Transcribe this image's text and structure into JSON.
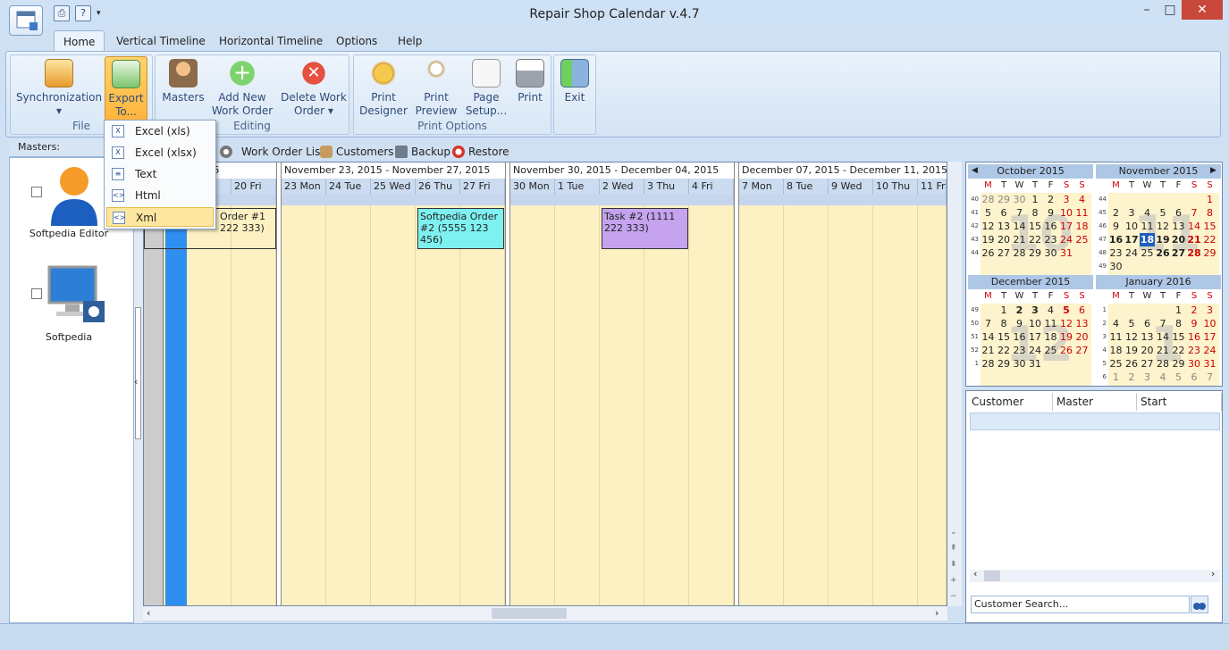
{
  "app": {
    "title": "Repair Shop Calendar v.4.7"
  },
  "tabs": [
    "Home",
    "Vertical Timeline",
    "Horizontal Timeline",
    "Options",
    "Help"
  ],
  "ribbon": {
    "file": {
      "label": "File",
      "sync": "Synchronization",
      "export1": "Export",
      "export2": "To..."
    },
    "editing": {
      "label": "Editing",
      "masters": "Masters",
      "add1": "Add New",
      "add2": "Work Order",
      "del1": "Delete Work",
      "del2": "Order"
    },
    "print": {
      "label": "Print Options",
      "designer1": "Print",
      "designer2": "Designer",
      "preview1": "Print",
      "preview2": "Preview",
      "setup1": "Page",
      "setup2": "Setup...",
      "print": "Print"
    },
    "exit": "Exit"
  },
  "export_menu": [
    "Excel (xls)",
    "Excel (xlsx)",
    "Text",
    "Html",
    "Xml"
  ],
  "masters": {
    "title": "Masters:",
    "items": [
      {
        "name": "Softpedia Editor"
      },
      {
        "name": "Softpedia"
      }
    ]
  },
  "toolbar": {
    "work_order_list": "Work Order List",
    "customers": "Customers",
    "backup": "Backup",
    "restore": "Restore"
  },
  "grid": {
    "weeks": [
      {
        "title": "mber 20, 2015",
        "days": [
          "",
          "20 Fri"
        ]
      },
      {
        "title": "November 23, 2015 - November 27, 2015",
        "days": [
          "23 Mon",
          "24 Tue",
          "25 Wed",
          "26 Thu",
          "27 Fri"
        ]
      },
      {
        "title": "November 30, 2015 - December 04, 2015",
        "days": [
          "30 Mon",
          "1 Tue",
          "2 Wed",
          "3 Thu",
          "4 Fri"
        ]
      },
      {
        "title": "December 07, 2015 - December 11, 2015",
        "days": [
          "7 Mon",
          "8 Tue",
          "9 Wed",
          "10 Thu",
          "11 Fri"
        ]
      }
    ],
    "appointments": [
      {
        "text": "Order #1\n222 333)",
        "color": "#fb8c7c"
      },
      {
        "text": "Softpedia Order #2 (5555 123 456)",
        "color": "#7ff0f0"
      },
      {
        "text": "Task #2 (1111 222 333)",
        "color": "#c5a3ef"
      }
    ]
  },
  "calendars": {
    "dow": [
      "M",
      "T",
      "W",
      "T",
      "F",
      "S",
      "S"
    ],
    "months": [
      {
        "title": "October 2015",
        "watermark": "10",
        "weeks": [
          "40",
          "41",
          "42",
          "43",
          "44"
        ],
        "rows": [
          [
            "28",
            "29",
            "30",
            "1",
            "2",
            "3",
            "4"
          ],
          [
            "5",
            "6",
            "7",
            "8",
            "9",
            "10",
            "11"
          ],
          [
            "12",
            "13",
            "14",
            "15",
            "16",
            "17",
            "18"
          ],
          [
            "19",
            "20",
            "21",
            "22",
            "23",
            "24",
            "25"
          ],
          [
            "26",
            "27",
            "28",
            "29",
            "30",
            "31",
            ""
          ]
        ]
      },
      {
        "title": "November 2015",
        "watermark": "11",
        "weeks": [
          "44",
          "45",
          "46",
          "47",
          "48",
          "49"
        ],
        "rows": [
          [
            "",
            "",
            "",
            "",
            "",
            "",
            "1"
          ],
          [
            "2",
            "3",
            "4",
            "5",
            "6",
            "7",
            "8"
          ],
          [
            "9",
            "10",
            "11",
            "12",
            "13",
            "14",
            "15"
          ],
          [
            "16",
            "17",
            "18",
            "19",
            "20",
            "21",
            "22"
          ],
          [
            "23",
            "24",
            "25",
            "26",
            "27",
            "28",
            "29"
          ],
          [
            "30",
            "",
            "",
            "",
            "",
            "",
            ""
          ]
        ]
      },
      {
        "title": "December 2015",
        "watermark": "12",
        "weeks": [
          "49",
          "50",
          "51",
          "52",
          "1"
        ],
        "rows": [
          [
            "",
            "1",
            "2",
            "3",
            "4",
            "5",
            "6"
          ],
          [
            "7",
            "8",
            "9",
            "10",
            "11",
            "12",
            "13"
          ],
          [
            "14",
            "15",
            "16",
            "17",
            "18",
            "19",
            "20"
          ],
          [
            "21",
            "22",
            "23",
            "24",
            "25",
            "26",
            "27"
          ],
          [
            "28",
            "29",
            "30",
            "31",
            "",
            "",
            ""
          ]
        ]
      },
      {
        "title": "January 2016",
        "watermark": "1",
        "weeks": [
          "1",
          "2",
          "3",
          "4",
          "5",
          "6"
        ],
        "rows": [
          [
            "",
            "",
            "",
            "",
            "1",
            "2",
            "3"
          ],
          [
            "4",
            "5",
            "6",
            "7",
            "8",
            "9",
            "10"
          ],
          [
            "11",
            "12",
            "13",
            "14",
            "15",
            "16",
            "17"
          ],
          [
            "18",
            "19",
            "20",
            "21",
            "22",
            "23",
            "24"
          ],
          [
            "25",
            "26",
            "27",
            "28",
            "29",
            "30",
            "31"
          ],
          [
            "1",
            "2",
            "3",
            "4",
            "5",
            "6",
            "7"
          ]
        ]
      }
    ]
  },
  "customers": {
    "columns": [
      "Customer",
      "Master",
      "Start"
    ],
    "search_placeholder": "Customer Search..."
  },
  "colors": {
    "accent": "#ffb53d",
    "selected_day": "#1f5fbf",
    "weekend": "#cc0000",
    "grid_bg": "#fdf0c3"
  }
}
